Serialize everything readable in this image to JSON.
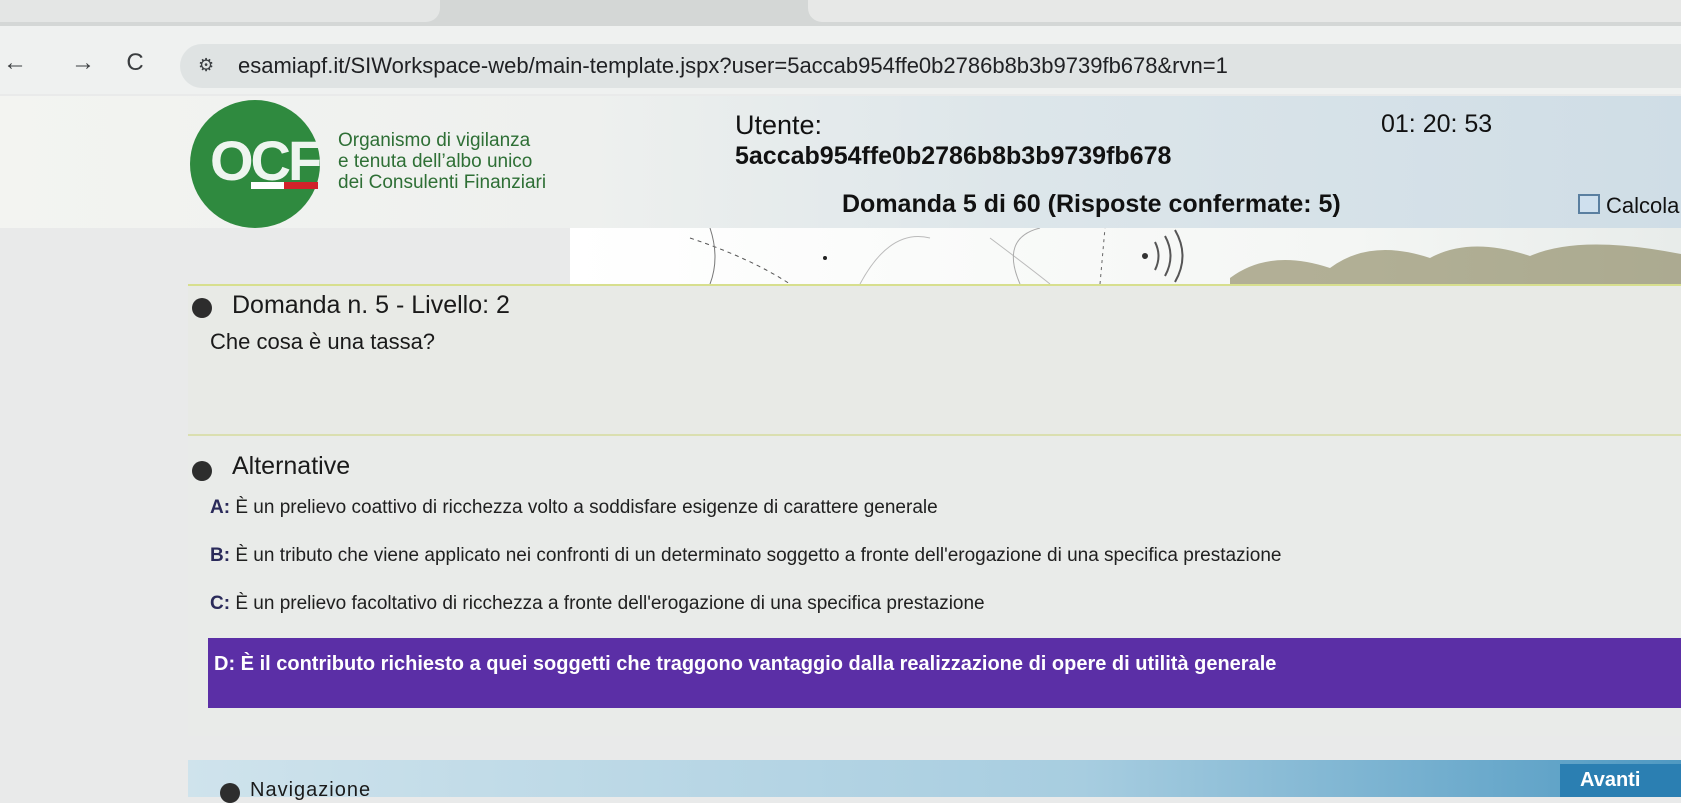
{
  "browser": {
    "back_icon": "←",
    "forward_icon": "→",
    "reload_icon": "C",
    "site_info_icon": "⚙",
    "url": "esamiapf.it/SIWorkspace-web/main-template.jspx?user=5accab954ffe0b2786b8b3b9739fb678&rvn=1"
  },
  "header": {
    "logo_text": "OCF",
    "org_line1": "Organismo di vigilanza",
    "org_line2": "e tenuta dell’albo unico",
    "org_line3": "dei Consulenti Finanziari",
    "user_label": "Utente:",
    "user_id": "5accab954ffe0b2786b8b3b9739fb678",
    "timer": "01: 20: 53",
    "question_counter": "Domanda 5 di 60 (Risposte confermate: 5)",
    "calc_label": "Calcola"
  },
  "question": {
    "title": "Domanda n. 5 - Livello: 2",
    "text": "Che cosa è una tassa?"
  },
  "alternatives": {
    "title": "Alternative",
    "items": [
      {
        "letter": "A:",
        "text": "È un prelievo coattivo di ricchezza volto a soddisfare esigenze di carattere generale"
      },
      {
        "letter": "B:",
        "text": "È un tributo che viene applicato nei confronti di un determinato soggetto a fronte dell'erogazione di una specifica prestazione"
      },
      {
        "letter": "C:",
        "text": "È un prelievo facoltativo di ricchezza a fronte dell'erogazione di una specifica prestazione"
      },
      {
        "letter": "D:",
        "text": "È il contributo richiesto a quei soggetti che traggono vantaggio dalla realizzazione di opere di utilità generale"
      }
    ],
    "selected": "D"
  },
  "navigation": {
    "title": "Navigazione",
    "next_label": "Avanti"
  },
  "colors": {
    "selected_bg": "#5b2fa6",
    "logo_green": "#2f8a3f",
    "next_button": "#2b7fb2"
  }
}
